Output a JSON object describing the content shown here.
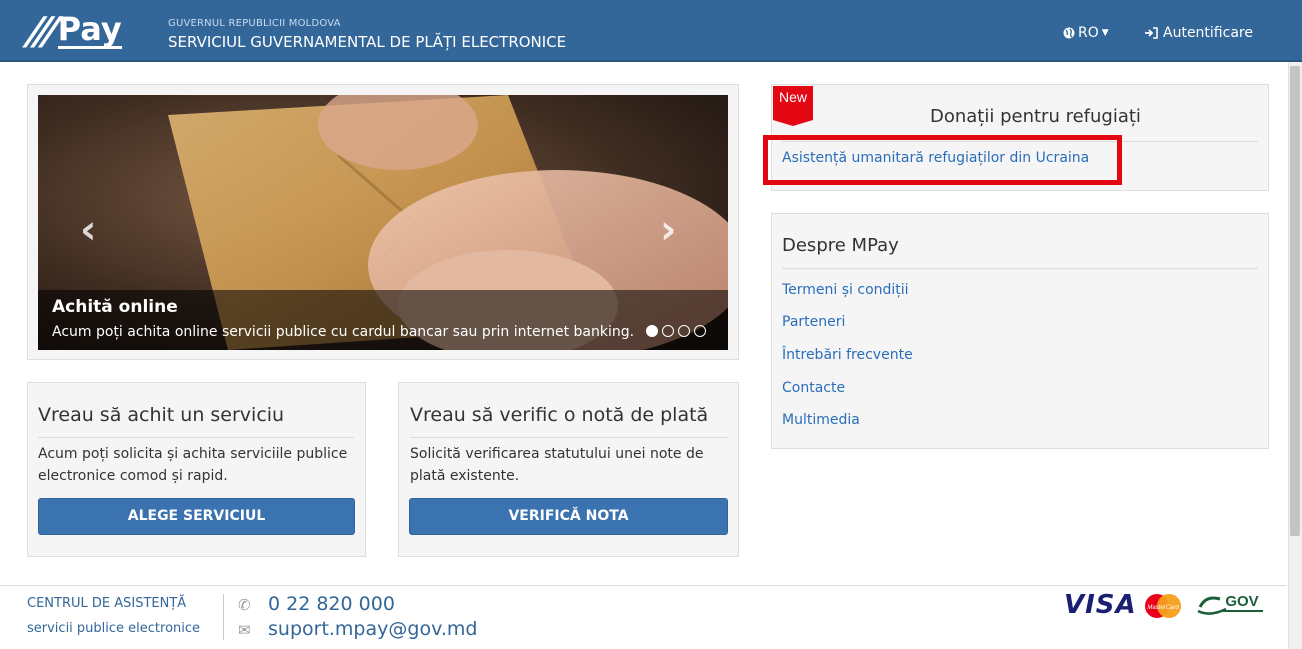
{
  "header": {
    "logo_text": "Pay",
    "gov_top": "GUVERNUL REPUBLICII MOLDOVA",
    "gov_sub": "SERVICIUL GUVERNAMENTAL DE PLĂȚI ELECTRONICE",
    "lang": "RO",
    "auth": "Autentificare"
  },
  "carousel": {
    "title": "Achită online",
    "text": "Acum poți achita online servicii publice cu cardul bancar sau prin internet banking.",
    "slide_count": 4,
    "active_slide": 1
  },
  "cards": [
    {
      "title": "Vreau să achit un serviciu",
      "text": "Acum poți solicita și achita serviciile publice electronice comod și rapid.",
      "button": "ALEGE SERVICIUL"
    },
    {
      "title": "Vreau să verific o notă de plată",
      "text": "Solicită verificarea statutului unei note de plată existente.",
      "button": "VERIFICĂ NOTA"
    }
  ],
  "donations": {
    "badge": "New",
    "title": "Donații pentru refugiați",
    "link": "Asistență umanitară refugiaților din Ucraina"
  },
  "despre": {
    "title": "Despre MPay",
    "links": [
      "Termeni și condiții",
      "Parteneri",
      "Întrebări frecvente",
      "Contacte",
      "Multimedia"
    ]
  },
  "footer": {
    "centre": "CENTRUL DE ASISTENȚĂ",
    "services": "servicii publice electronice",
    "phone": "0 22 820 000",
    "email": "suport.mpay@gov.md",
    "visa": "VISA",
    "mastercard": "MasterCard",
    "egov": "GOV"
  },
  "colors": {
    "header": "#336699",
    "button": "#3a73b0",
    "link": "#2a6ebb",
    "highlight": "#e30613"
  }
}
